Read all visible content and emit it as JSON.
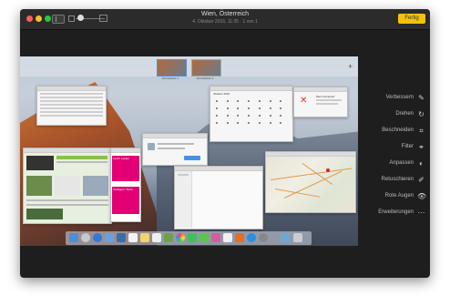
{
  "window": {
    "title": "Wien, Österreich",
    "subtitle": "4. Oktober 2016, 11:35  ·  1 von 1",
    "done_label": "Fertig"
  },
  "toolbar": {
    "icons": [
      "sidebar-icon",
      "zoom-small-icon",
      "zoom-slider",
      "zoom-large-icon"
    ]
  },
  "photo": {
    "mission_control": {
      "desktops": [
        "Schreibtisch 1",
        "Schreibtisch 2"
      ],
      "add_symbol": "+"
    },
    "window_titles": {
      "calendar": "Oktober 2016",
      "info": "Mein Computer",
      "web_ad_1": "Leicht Laufen",
      "web_ad_2": "Intelligenz Tarife"
    }
  },
  "edit_tools": [
    {
      "label": "Verbessern",
      "icon": "magic-wand-icon",
      "glyph": "✎"
    },
    {
      "label": "Drehen",
      "icon": "rotate-icon",
      "glyph": "↻"
    },
    {
      "label": "Beschneiden",
      "icon": "crop-icon",
      "glyph": "⌗"
    },
    {
      "label": "Filter",
      "icon": "filter-icon",
      "glyph": "⚭"
    },
    {
      "label": "Anpassen",
      "icon": "adjust-icon",
      "glyph": "◐"
    },
    {
      "label": "Retuschieren",
      "icon": "retouch-icon",
      "glyph": "✐"
    },
    {
      "label": "Rote Augen",
      "icon": "red-eye-icon",
      "glyph": "👁"
    },
    {
      "label": "Erweiterungen",
      "icon": "extensions-icon",
      "glyph": "⋯"
    }
  ],
  "colors": {
    "done_button": "#f4c20d",
    "window_bg": "#1e1e1e"
  }
}
